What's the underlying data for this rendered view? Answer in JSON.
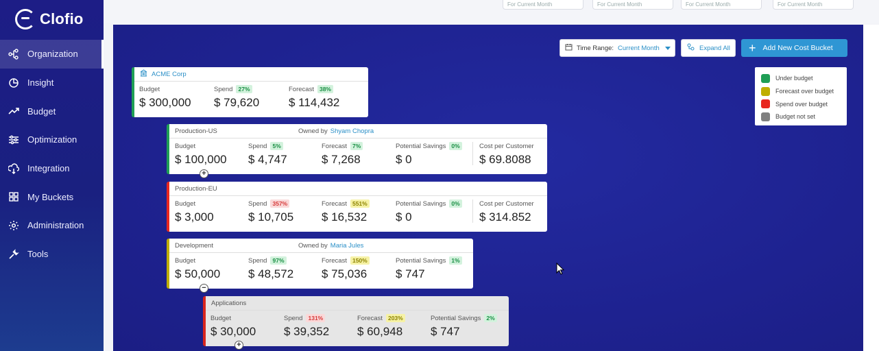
{
  "app": {
    "name": "Clofio"
  },
  "sidebar": {
    "items": [
      {
        "label": "Organization",
        "icon": "hierarchy-icon",
        "active": true
      },
      {
        "label": "Insight",
        "icon": "insight-icon"
      },
      {
        "label": "Budget",
        "icon": "trend-icon"
      },
      {
        "label": "Optimization",
        "icon": "sliders-icon"
      },
      {
        "label": "Integration",
        "icon": "integration-icon"
      },
      {
        "label": "My Buckets",
        "icon": "buckets-icon"
      },
      {
        "label": "Administration",
        "icon": "gear-icon"
      },
      {
        "label": "Tools",
        "icon": "wrench-icon"
      }
    ]
  },
  "topbar": {
    "fields": [
      "For Current Month",
      "For Current Month",
      "For Current Month",
      "For Current Month"
    ]
  },
  "toolbar": {
    "time_range_label": "Time Range:",
    "time_range_value": "Current Month",
    "expand_label": "Expand All",
    "add_label": "Add New Cost Bucket"
  },
  "legend": {
    "items": [
      {
        "label": "Under budget",
        "color": "#1f9e55"
      },
      {
        "label": "Forecast over budget",
        "color": "#bfae00"
      },
      {
        "label": "Spend over budget",
        "color": "#e8271f"
      },
      {
        "label": "Budget not set",
        "color": "#808080"
      }
    ]
  },
  "labels": {
    "budget": "Budget",
    "spend": "Spend",
    "forecast": "Forecast",
    "potential_savings": "Potential Savings",
    "cost_per_customer": "Cost per Customer",
    "owned_by": "Owned by"
  },
  "buckets": [
    {
      "name": "ACME Corp",
      "budget": "$ 300,000",
      "spend": "$ 79,620",
      "spend_pct": "27%",
      "forecast": "$ 114,432",
      "forecast_pct": "38%"
    },
    {
      "name": "Production-US",
      "owner": "Shyam Chopra",
      "budget": "$ 100,000",
      "spend": "$ 4,747",
      "spend_pct": "5%",
      "forecast": "$ 7,268",
      "forecast_pct": "7%",
      "savings": "$ 0",
      "savings_pct": "0%",
      "cost_per_customer": "$ 69.8088"
    },
    {
      "name": "Production-EU",
      "budget": "$ 3,000",
      "spend": "$ 10,705",
      "spend_pct": "357%",
      "forecast": "$ 16,532",
      "forecast_pct": "551%",
      "savings": "$ 0",
      "savings_pct": "0%",
      "cost_per_customer": "$ 314.852"
    },
    {
      "name": "Development",
      "owner": "Maria Jules",
      "budget": "$ 50,000",
      "spend": "$ 48,572",
      "spend_pct": "97%",
      "forecast": "$ 75,036",
      "forecast_pct": "150%",
      "savings": "$ 747",
      "savings_pct": "1%"
    },
    {
      "name": "Applications",
      "budget": "$ 30,000",
      "spend": "$ 39,352",
      "spend_pct": "131%",
      "forecast": "$ 60,948",
      "forecast_pct": "203%",
      "savings": "$ 747",
      "savings_pct": "2%"
    }
  ]
}
